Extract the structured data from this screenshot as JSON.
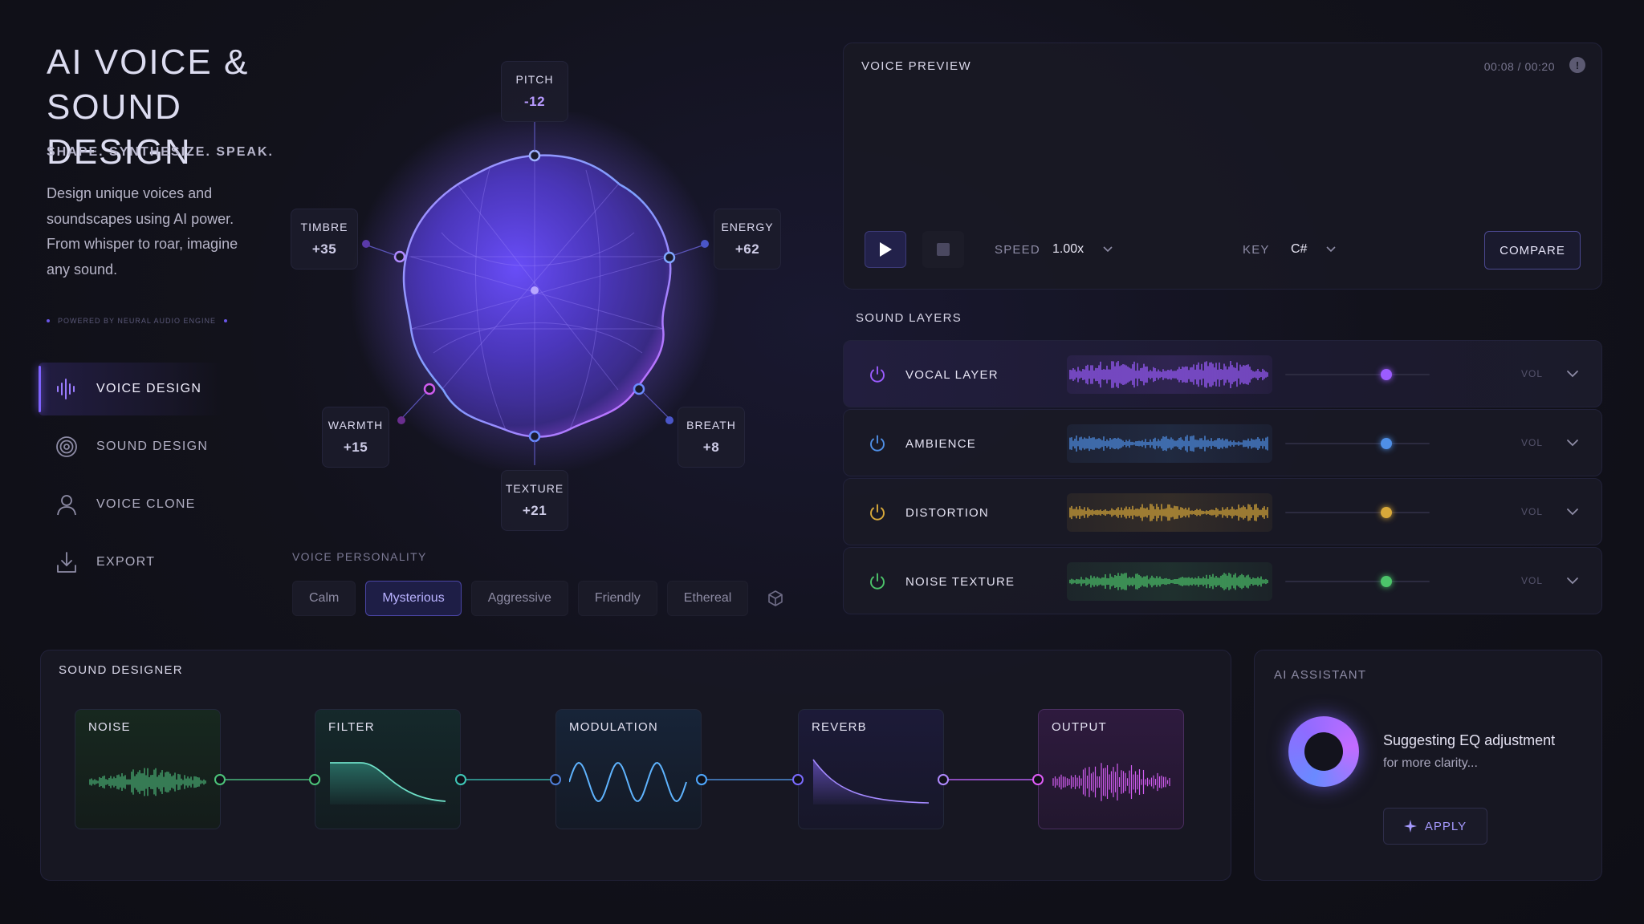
{
  "app": {
    "title": "AI VOICE & SOUND DESIGN",
    "tagline": "SHAPE. SYNTHESIZE. SPEAK.",
    "description": "Design unique voices and soundscapes using AI power. From whisper to roar, imagine any sound.",
    "powered": "POWERED BY NEURAL AUDIO ENGINE"
  },
  "nav": {
    "items": [
      {
        "label": "VOICE DESIGN",
        "icon": "waveform-icon",
        "active": true
      },
      {
        "label": "SOUND DESIGN",
        "icon": "target-icon",
        "active": false
      },
      {
        "label": "VOICE CLONE",
        "icon": "user-icon",
        "active": false
      },
      {
        "label": "EXPORT",
        "icon": "download-icon",
        "active": false
      }
    ]
  },
  "voice_params": {
    "pitch": {
      "label": "PITCH",
      "value": "-12"
    },
    "energy": {
      "label": "ENERGY",
      "value": "+62"
    },
    "breath": {
      "label": "BREATH",
      "value": "+8"
    },
    "texture": {
      "label": "TEXTURE",
      "value": "+21"
    },
    "warmth": {
      "label": "WARMTH",
      "value": "+15"
    },
    "timbre": {
      "label": "TIMBRE",
      "value": "+35"
    }
  },
  "personality": {
    "label": "VOICE PERSONALITY",
    "options": [
      "Calm",
      "Mysterious",
      "Aggressive",
      "Friendly",
      "Ethereal"
    ],
    "selected": "Mysterious",
    "randomize_icon": "cube-icon"
  },
  "preview": {
    "title": "VOICE PREVIEW",
    "time": "00:08 / 00:20",
    "speed_label": "SPEED",
    "speed_value": "1.00x",
    "key_label": "KEY",
    "key_value": "C#",
    "compare_label": "COMPARE",
    "accent": "#7b5cff"
  },
  "layers": {
    "title": "SOUND LAYERS",
    "vol_label": "VOL",
    "items": [
      {
        "name": "VOCAL LAYER",
        "color": "#9b5cff",
        "volume": 0.7,
        "active": true
      },
      {
        "name": "AMBIENCE",
        "color": "#4f8fe6",
        "volume": 0.7,
        "active": false
      },
      {
        "name": "DISTORTION",
        "color": "#d9a93a",
        "volume": 0.7,
        "active": false
      },
      {
        "name": "NOISE TEXTURE",
        "color": "#4cc46a",
        "volume": 0.7,
        "active": false
      }
    ]
  },
  "designer": {
    "title": "SOUND DESIGNER",
    "modules": [
      {
        "label": "NOISE",
        "color": "#4cb87a"
      },
      {
        "label": "FILTER",
        "color": "#3fbfa8"
      },
      {
        "label": "MODULATION",
        "color": "#4fa8ff"
      },
      {
        "label": "REVERB",
        "color": "#8a6bff"
      },
      {
        "label": "OUTPUT",
        "color": "#d05cf0"
      }
    ]
  },
  "assistant": {
    "title": "AI ASSISTANT",
    "message": "Suggesting EQ adjustment",
    "sub": "for more clarity...",
    "apply_label": "APPLY"
  }
}
